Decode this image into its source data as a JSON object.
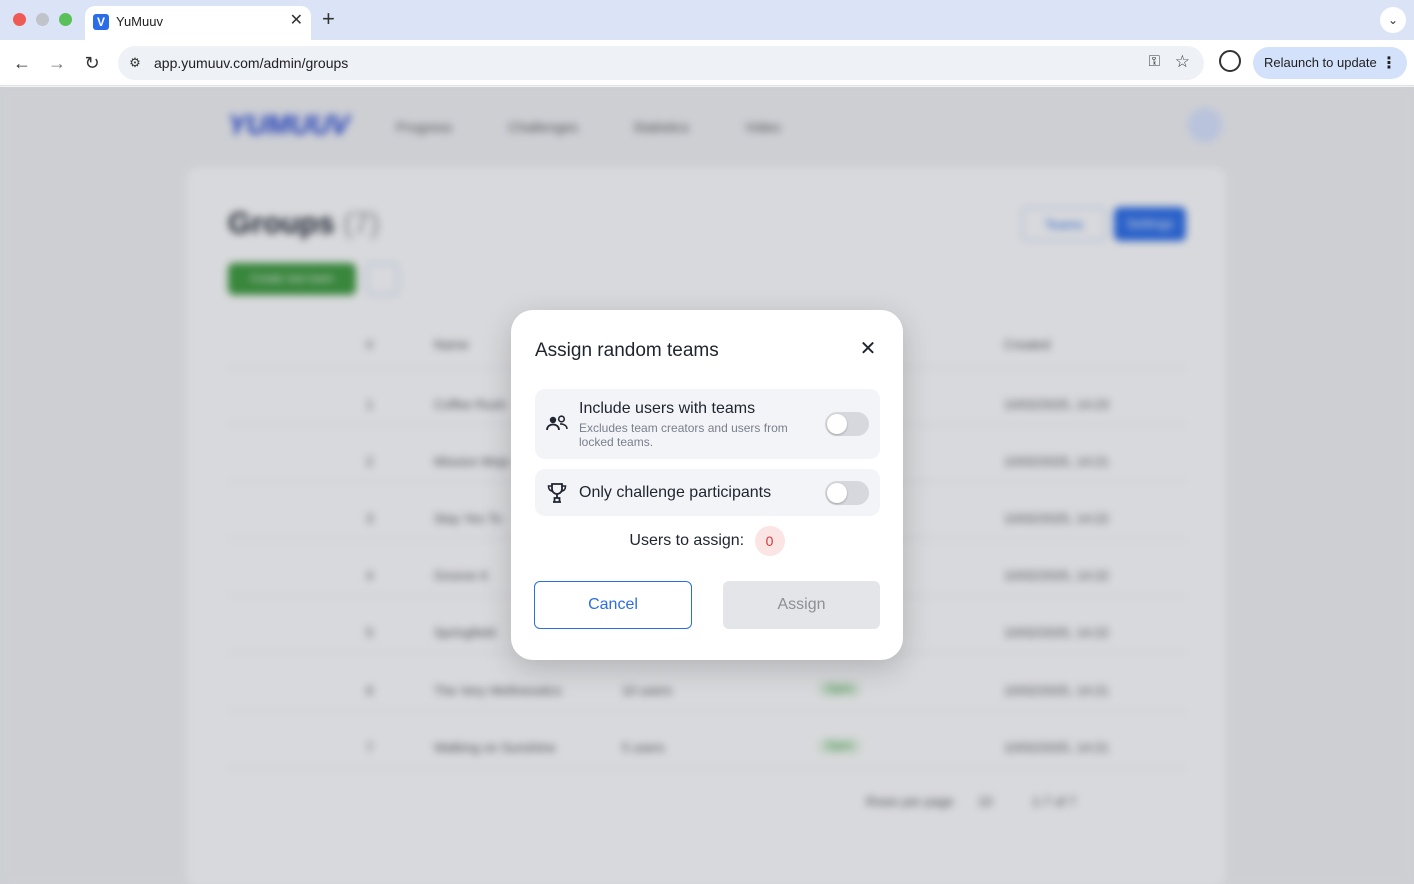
{
  "browser": {
    "tab_title": "YuMuuv",
    "tab_favicon_letter": "V",
    "url": "app.yumuuv.com/admin/groups",
    "relaunch_label": "Relaunch to update"
  },
  "app": {
    "logo": "YUMUUV",
    "nav": [
      "Progress",
      "Challenges",
      "Statistics",
      "Video"
    ],
    "page_title": "Groups",
    "page_count": "(7)",
    "create_button": "Create new team",
    "teams_button": "Teams",
    "settings_button": "Settings",
    "columns": [
      "#",
      "Name",
      "Created"
    ],
    "rows": [
      {
        "num": "1",
        "name": "Coffee Rush",
        "created": "10/02/2025, 14:23"
      },
      {
        "num": "2",
        "name": "Mission Mojo",
        "created": "10/02/2025, 14:21"
      },
      {
        "num": "3",
        "name": "Stay Yes To",
        "created": "10/02/2025, 14:22"
      },
      {
        "num": "4",
        "name": "Groove It",
        "created": "10/02/2025, 14:22"
      },
      {
        "num": "5",
        "name": "Springfield",
        "created": "10/02/2025, 14:22"
      },
      {
        "num": "6",
        "name": "The Very Wellnesstics",
        "users": "10 users",
        "status": "Open",
        "created": "10/02/2025, 14:21"
      },
      {
        "num": "7",
        "name": "Walking on Sunshine",
        "users": "5 users",
        "status": "Open",
        "created": "10/02/2025, 14:21"
      }
    ],
    "pagination": {
      "rows_label": "Rows per page",
      "rows_value": "10",
      "range": "1-7 of 7"
    }
  },
  "modal": {
    "title": "Assign random teams",
    "options": [
      {
        "icon": "users-icon",
        "label": "Include users with teams",
        "description": "Excludes team creators and users from locked teams.",
        "enabled": false
      },
      {
        "icon": "trophy-icon",
        "label": "Only challenge participants",
        "enabled": false
      }
    ],
    "assign_label": "Users to assign:",
    "assign_count": "0",
    "cancel_label": "Cancel",
    "assign_button_label": "Assign"
  },
  "colors": {
    "accent": "#2b6de8",
    "count_bg": "#fbe4e4",
    "count_text": "#d33a3a",
    "disabled_bg": "#e4e5e8"
  }
}
